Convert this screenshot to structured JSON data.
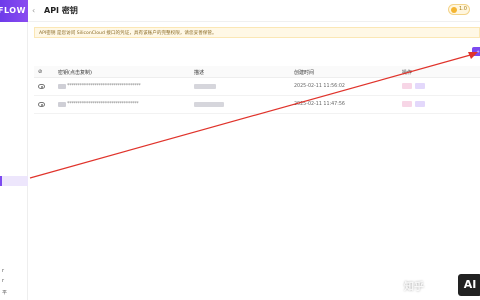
{
  "sidebar": {
    "logo_text": "FLOW",
    "bottom_items": [
      "r",
      "r",
      "平"
    ]
  },
  "header": {
    "back_glyph": "‹",
    "title": "API 密钥",
    "credit_value": "1.0"
  },
  "notice": {
    "text": "API密钥 是您访问 SiliconCloud 接口的凭证，具有该账户的完整权限，请您妥善保管。"
  },
  "create_button": {
    "label": "+"
  },
  "table": {
    "headers": {
      "toggle": "⊘",
      "key": "密钥(点击复制)",
      "description": "描述",
      "created_at": "创建时间",
      "actions": "操作"
    },
    "rows": [
      {
        "key_mask": "***********************************",
        "created_at": "2025-02-11 11:56:02"
      },
      {
        "key_mask": "**********************************",
        "created_at": "2025-02-11 11:47:56"
      }
    ]
  },
  "watermark": {
    "text": "知乎",
    "badge": "AI"
  },
  "colors": {
    "brand": "#7c4af0",
    "annotation": "#e0332b",
    "notice_bg": "#fff8e6"
  }
}
